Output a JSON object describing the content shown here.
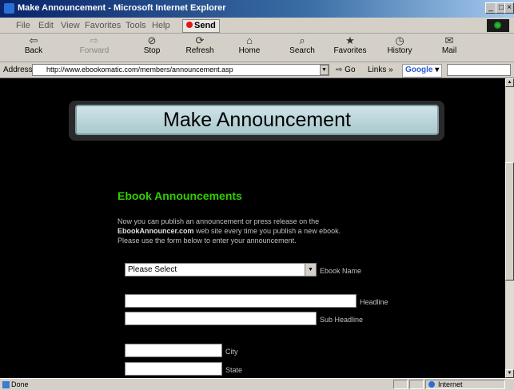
{
  "window": {
    "title": "Make Announcement - Microsoft Internet Explorer"
  },
  "menu": [
    "File",
    "Edit",
    "View",
    "Favorites",
    "Tools",
    "Help"
  ],
  "send_label": "Send",
  "toolbar": {
    "back": "Back",
    "forward": "Forward",
    "stop": "Stop",
    "refresh": "Refresh",
    "home": "Home",
    "search": "Search",
    "favorites": "Favorites",
    "history": "History",
    "mail": "Mail"
  },
  "address": {
    "label": "Address",
    "url": "http://www.ebookomatic.com/members/announcement.asp",
    "go": "Go",
    "links": "Links »",
    "google": "Google"
  },
  "page": {
    "banner": "Make Announcement",
    "section_title": "Ebook Announcements",
    "intro_1": "Now you can publish an announcement or press release on the",
    "intro_site": "EbookAnnouncer.com",
    "intro_2": " web site every time you publish a new ebook.",
    "intro_3": "Please use the form below to enter your announcement.",
    "select_value": "Please Select",
    "label_ebook_name": "Ebook Name",
    "label_headline": "Headline",
    "label_sub_headline": "Sub Headline",
    "label_city": "City",
    "label_state": "State"
  },
  "status": {
    "text": "Done",
    "zone": "Internet"
  },
  "colors": {
    "accent_green": "#33cc00",
    "page_bg": "#000000",
    "banner_bg": "#cfe4e8"
  }
}
